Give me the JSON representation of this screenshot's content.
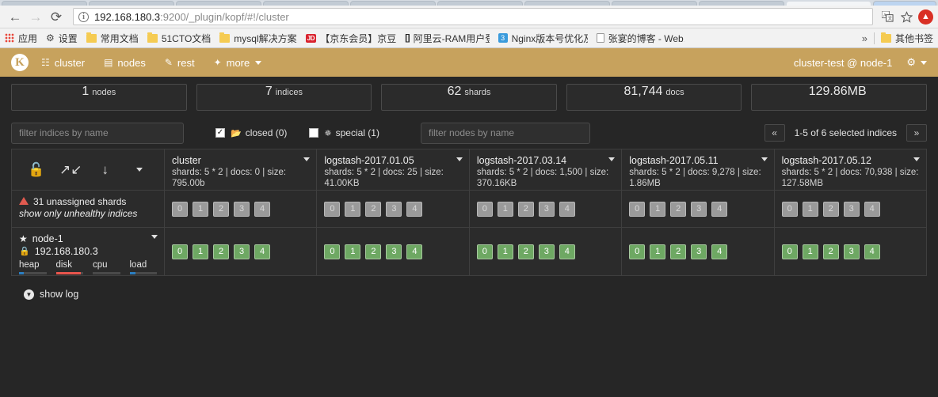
{
  "browser": {
    "url_host": "192.168.180.3",
    "url_rest": ":9200/_plugin/kopf/#!/cluster",
    "back_icon": "back-arrow-icon",
    "forward_icon": "forward-arrow-icon",
    "reload_icon": "reload-icon",
    "info_icon": "info-icon",
    "translate_icon": "translate-icon",
    "star_icon": "star-icon",
    "update_icon": "update-arrow-icon",
    "bookmarks": [
      {
        "label": "应用",
        "icon": "apps-grid-icon"
      },
      {
        "label": "设置",
        "icon": "gear-icon"
      },
      {
        "label": "常用文档",
        "icon": "folder-icon"
      },
      {
        "label": "51CTO文档",
        "icon": "folder-icon"
      },
      {
        "label": "mysql解决方案",
        "icon": "folder-icon"
      },
      {
        "label": "【京东会员】京豆免",
        "icon": "jd-icon"
      },
      {
        "label": "阿里云-RAM用户登录",
        "icon": "aliyun-icon"
      },
      {
        "label": "Nginx版本号优化及设",
        "icon": "nginx-icon"
      },
      {
        "label": "张宴的博客 - Web系统",
        "icon": "page-icon"
      }
    ],
    "overflow_label": "»",
    "other_bookmarks": {
      "label": "其他书签",
      "icon": "folder-icon"
    }
  },
  "navbar": {
    "brand": "K",
    "items": [
      {
        "label": "cluster",
        "icon": "cluster-icon"
      },
      {
        "label": "nodes",
        "icon": "nodes-icon"
      },
      {
        "label": "rest",
        "icon": "rest-icon"
      },
      {
        "label": "more",
        "icon": "magic-wand-icon"
      }
    ],
    "cluster_label": "cluster-test @ node-1",
    "gear_icon": "gear-icon"
  },
  "stats": [
    {
      "num": "1",
      "unit": "nodes"
    },
    {
      "num": "7",
      "unit": "indices"
    },
    {
      "num": "62",
      "unit": "shards"
    },
    {
      "num": "81,744",
      "unit": "docs"
    },
    {
      "num": "129.86MB",
      "unit": ""
    }
  ],
  "filters": {
    "indices_placeholder": "filter indices by name",
    "nodes_placeholder": "filter nodes by name",
    "closed": {
      "label": "closed (0)",
      "checked": true,
      "icon": "folder-icon"
    },
    "special": {
      "label": "special (1)",
      "checked": false,
      "icon": "asterisk-icon"
    },
    "pager": {
      "prev": "«",
      "next": "»",
      "text": "1-5 of 6 selected indices"
    }
  },
  "table": {
    "tools": [
      {
        "icon": "unlock-icon"
      },
      {
        "icon": "expand-arrows-icon"
      },
      {
        "icon": "sort-alpha-icon"
      },
      {
        "icon": "caret-down-icon"
      }
    ],
    "indices": [
      {
        "name": "cluster",
        "meta": "shards: 5 * 2 | docs: 0 | size: 795.00b"
      },
      {
        "name": "logstash-2017.01.05",
        "meta": "shards: 5 * 2 | docs: 25 | size: 41.00KB"
      },
      {
        "name": "logstash-2017.03.14",
        "meta": "shards: 5 * 2 | docs: 1,500 | size: 370.16KB"
      },
      {
        "name": "logstash-2017.05.11",
        "meta": "shards: 5 * 2 | docs: 9,278 | size: 1.86MB"
      },
      {
        "name": "logstash-2017.05.12",
        "meta": "shards: 5 * 2 | docs: 70,938 | size: 127.58MB"
      }
    ],
    "unassigned": {
      "title": "31 unassigned shards",
      "link": "show only unhealthy indices",
      "warn_icon": "warning-triangle-icon",
      "shards": [
        "0",
        "1",
        "2",
        "3",
        "4"
      ]
    },
    "node": {
      "name": "node-1",
      "ip": "192.168.180.3",
      "master_icon": "star-icon",
      "host_icon": "lock-icon",
      "metrics": [
        {
          "label": "heap",
          "percent": 16,
          "color": "#2b7ec1"
        },
        {
          "label": "disk",
          "percent": 92,
          "color": "#e8554d"
        },
        {
          "label": "cpu",
          "percent": 0,
          "color": "#2b7ec1"
        },
        {
          "label": "load",
          "percent": 22,
          "color": "#2b7ec1"
        }
      ],
      "shards": [
        "0",
        "1",
        "2",
        "3",
        "4"
      ]
    }
  },
  "footer": {
    "show_log": "show log",
    "show_log_icon": "circle-chevron-down-icon"
  },
  "colors": {
    "navbar": "#c7a25d",
    "page_bg": "#262626",
    "shard_green": "#6ea863",
    "shard_gray": "#9a9a9a",
    "warning_red": "#e05a4f"
  }
}
